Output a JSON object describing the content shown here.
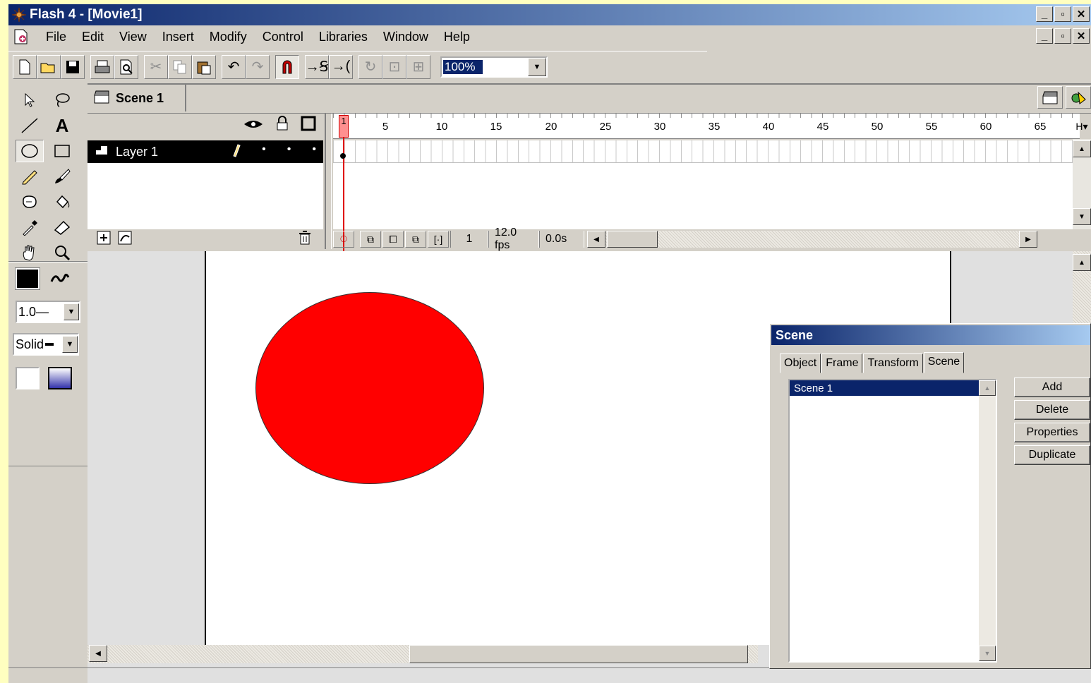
{
  "window": {
    "title": "Flash 4 - [Movie1]",
    "btn_min": "_",
    "btn_max": "▫",
    "btn_close": "✕"
  },
  "menu": {
    "items": [
      "File",
      "Edit",
      "View",
      "Insert",
      "Modify",
      "Control",
      "Libraries",
      "Window",
      "Help"
    ]
  },
  "toolbar": {
    "zoom_value": "100%"
  },
  "tools": {
    "line_width": "1.0—",
    "line_style": "Solid"
  },
  "scene_bar": {
    "scene_name": "Scene 1"
  },
  "timeline": {
    "layer_name": "Layer 1",
    "ruler_labels": [
      "1",
      "5",
      "10",
      "15",
      "20",
      "25",
      "30",
      "35",
      "40",
      "45",
      "50",
      "55",
      "60",
      "65"
    ],
    "current_frame": "1",
    "frame_rate": "12.0 fps",
    "elapsed_time": "0.0s"
  },
  "stage": {
    "shape": "circle",
    "fill_color": "#ff0000"
  },
  "scene_panel": {
    "title": "Scene",
    "tabs": [
      "Object",
      "Frame",
      "Transform",
      "Scene"
    ],
    "active_tab": "Scene",
    "scenes": [
      "Scene 1"
    ],
    "buttons": {
      "add": "Add",
      "delete": "Delete",
      "properties": "Properties",
      "duplicate": "Duplicate"
    }
  },
  "colors": {
    "title_bar_start": "#0a246a",
    "title_bar_end": "#a6caf0",
    "chrome": "#d4d0c8",
    "page_background": "#ffffc0"
  }
}
